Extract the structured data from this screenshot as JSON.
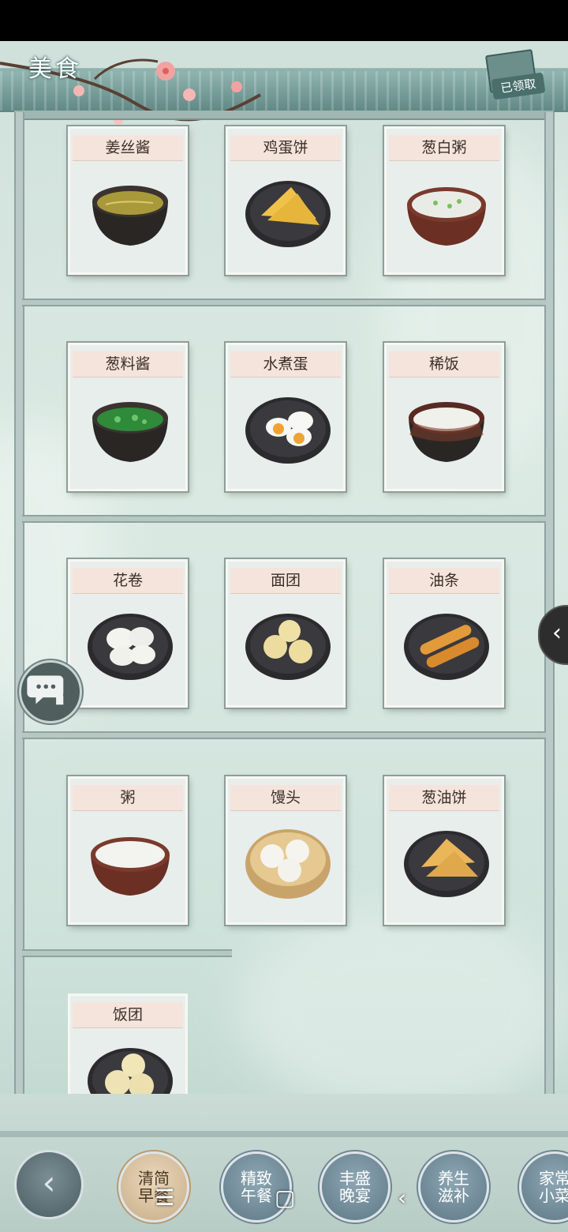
{
  "header": {
    "title": "美食",
    "receipt_label": "已领取"
  },
  "foods": [
    {
      "name": "姜丝酱",
      "dish": "bowl-ginger"
    },
    {
      "name": "鸡蛋饼",
      "dish": "plate-eggcake"
    },
    {
      "name": "葱白粥",
      "dish": "pot-congee"
    },
    {
      "name": "葱料酱",
      "dish": "bowl-scallion"
    },
    {
      "name": "水煮蛋",
      "dish": "plate-egg"
    },
    {
      "name": "稀饭",
      "dish": "bowl-rice"
    },
    {
      "name": "花卷",
      "dish": "plate-huajuan"
    },
    {
      "name": "面团",
      "dish": "plate-dough"
    },
    {
      "name": "油条",
      "dish": "plate-youtiao"
    },
    {
      "name": "粥",
      "dish": "pot-porridge"
    },
    {
      "name": "馒头",
      "dish": "steamer-mantou"
    },
    {
      "name": "葱油饼",
      "dish": "plate-pancake"
    },
    {
      "name": "饭团",
      "dish": "plate-riceball"
    }
  ],
  "bottom_nav": [
    {
      "label": "清简早餐",
      "active": true
    },
    {
      "label": "精致午餐",
      "active": false
    },
    {
      "label": "丰盛晚宴",
      "active": false
    },
    {
      "label": "养生滋补",
      "active": false
    },
    {
      "label": "家常小菜",
      "active": false
    }
  ],
  "icons": {
    "back": "back-arrow-icon",
    "side": "chevron-left-icon",
    "chat": "chat-bubble-icon"
  }
}
